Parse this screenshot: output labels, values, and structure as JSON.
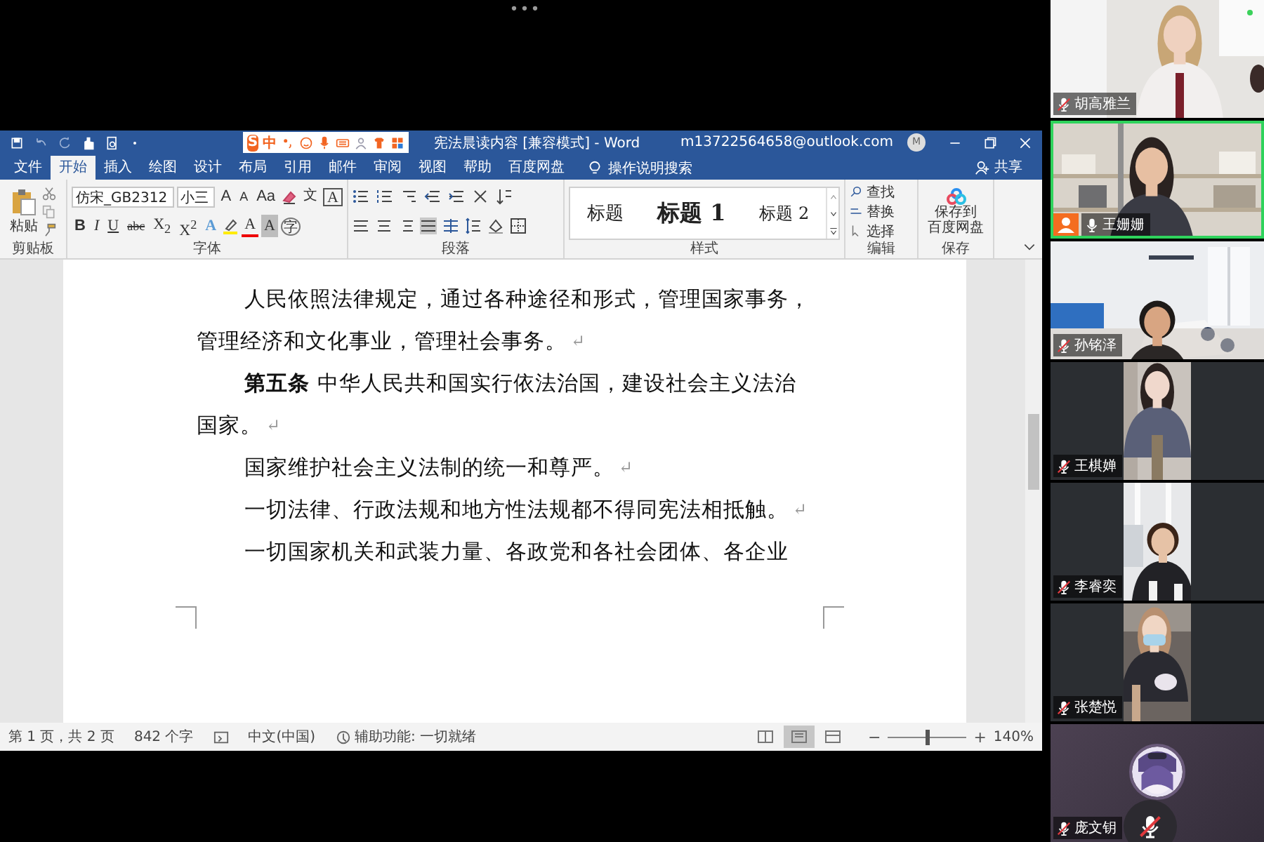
{
  "meeting": {
    "more_button": "•••"
  },
  "word": {
    "ime": {
      "logo": "S",
      "mode": "中"
    },
    "title": "宪法晨读内容 [兼容模式] - Word",
    "account": "m13722564658@outlook.com",
    "avatar_initial": "M",
    "tabs": [
      {
        "label": "文件",
        "selected": false
      },
      {
        "label": "开始",
        "selected": true
      },
      {
        "label": "插入",
        "selected": false
      },
      {
        "label": "绘图",
        "selected": false
      },
      {
        "label": "设计",
        "selected": false
      },
      {
        "label": "布局",
        "selected": false
      },
      {
        "label": "引用",
        "selected": false
      },
      {
        "label": "邮件",
        "selected": false
      },
      {
        "label": "审阅",
        "selected": false
      },
      {
        "label": "视图",
        "selected": false
      },
      {
        "label": "帮助",
        "selected": false
      },
      {
        "label": "百度网盘",
        "selected": false
      }
    ],
    "search_hint": "操作说明搜索",
    "share": "共享",
    "ribbon": {
      "clipboard": {
        "paste": "粘贴",
        "label": "剪贴板"
      },
      "font": {
        "name": "仿宋_GB2312",
        "size": "小三",
        "label": "字体",
        "row1": [
          {
            "kind": "grow",
            "text": "A"
          },
          {
            "kind": "shrink",
            "text": "A"
          },
          {
            "kind": "case",
            "text": "Aa"
          },
          {
            "kind": "clear"
          },
          {
            "kind": "phonetic",
            "text": "文"
          },
          {
            "kind": "border",
            "text": "A"
          }
        ],
        "row2": [
          {
            "kind": "bold",
            "text": "B"
          },
          {
            "kind": "italic",
            "text": "I"
          },
          {
            "kind": "underline",
            "text": "U"
          },
          {
            "kind": "strike",
            "text": "abc"
          },
          {
            "kind": "sub",
            "text": "X$_{2}$"
          },
          {
            "kind": "sup",
            "text": "X$^{2}$"
          },
          {
            "kind": "effects",
            "text": "A"
          },
          {
            "kind": "highlight"
          },
          {
            "kind": "color",
            "text": "A"
          },
          {
            "kind": "shade",
            "text": "A"
          },
          {
            "kind": "enclose",
            "text": "字"
          }
        ]
      },
      "paragraph": {
        "label": "段落"
      },
      "styles": {
        "items": [
          "标题",
          "标题 1",
          "标题 2"
        ],
        "label": "样式"
      },
      "editing": {
        "items": [
          "查找",
          "替换",
          "选择"
        ],
        "label": "编辑"
      },
      "save": {
        "lines": [
          "保存到",
          "百度网盘"
        ],
        "label": "保存"
      }
    },
    "document": {
      "lines": [
        {
          "text": "人民依照法律规定，通过各种途径和形式，管理国家事务，",
          "indent": true
        },
        {
          "text": "管理经济和文化事业，管理社会事务。",
          "indent": false,
          "end_mark": "↵"
        },
        {
          "text": "**第五条**  中华人民共和国实行依法治国，建设社会主义法治",
          "indent": true
        },
        {
          "text": "国家。",
          "indent": false,
          "end_mark": "↵"
        },
        {
          "text": "国家维护社会主义法制的统一和尊严。",
          "indent": true,
          "end_mark": "↵"
        },
        {
          "text": "一切法律、行政法规和地方性法规都不得同宪法相抵触。",
          "indent": true,
          "end_mark": "↵"
        },
        {
          "text": "一切国家机关和武装力量、各政党和各社会团体、各企业",
          "indent": true
        }
      ]
    },
    "status_bar": {
      "page": "第 1 页，共 2 页",
      "words": "842 个字",
      "language": "中文(中国)",
      "accessibility": "辅助功能: 一切就绪",
      "views": [
        {
          "selected": false
        },
        {
          "selected": true
        },
        {
          "selected": false
        }
      ],
      "zoom_minus": "−",
      "zoom_slider": {
        "level": 0.5
      },
      "zoom_plus": "+",
      "zoom": "140%"
    }
  },
  "participants": [
    {
      "name": "胡高雅兰",
      "muted": true,
      "speaking": false,
      "kind": "wide"
    },
    {
      "name": "王姗姗",
      "muted": false,
      "speaking": true,
      "kind": "wide",
      "badge": true
    },
    {
      "name": "孙铭泽",
      "muted": true,
      "speaking": false,
      "kind": "wide"
    },
    {
      "name": "王棋婵",
      "muted": true,
      "speaking": false,
      "kind": "portrait"
    },
    {
      "name": "李睿奕",
      "muted": true,
      "speaking": false,
      "kind": "portrait"
    },
    {
      "name": "张楚悦",
      "muted": true,
      "speaking": false,
      "kind": "portrait"
    },
    {
      "name": "庞文钥",
      "muted": true,
      "speaking": false,
      "kind": "avatar"
    }
  ]
}
